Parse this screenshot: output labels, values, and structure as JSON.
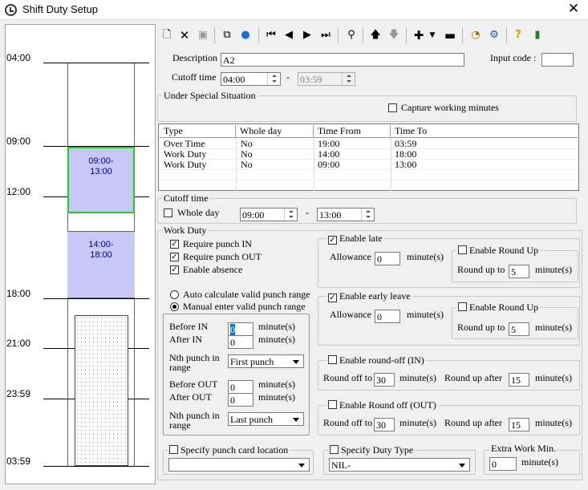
{
  "window": {
    "title": "Shift Duty Setup"
  },
  "timeline": {
    "labels": [
      "04:00",
      "09:00",
      "12:00",
      "18:00",
      "21:00",
      "23:59",
      "03:59"
    ],
    "blocks": [
      {
        "start": "09:00",
        "end": "13:00",
        "label": "09:00-\n13:00"
      },
      {
        "start": "14:00",
        "end": "18:00",
        "label": "14:00-\n18:00"
      }
    ]
  },
  "toolbar": {
    "icons": [
      "new-icon",
      "delete-icon",
      "save-icon",
      "copy-icon",
      "globe-icon",
      "first-icon",
      "prev-icon",
      "next-icon",
      "last-icon",
      "binoculars-icon",
      "up-arrow-icon",
      "down-arrow-icon",
      "add-icon",
      "dropdown-icon",
      "remove-icon",
      "clock-icon",
      "settings-icon",
      "help-icon",
      "exit-icon"
    ]
  },
  "form": {
    "description_label": "Description",
    "description": "A2",
    "input_code_label": "Input code :",
    "input_code": "",
    "cutoff_label": "Cutoff time",
    "cutoff_from": "04:00",
    "cutoff_dash": "-",
    "cutoff_to": "03:59"
  },
  "special": {
    "title": "Under Special Situation",
    "capture_label": "Capture working minutes"
  },
  "table": {
    "headers": [
      "Type",
      "Whole day",
      "Time From",
      "Time To"
    ],
    "rows": [
      [
        "Over Time",
        "No",
        "19:00",
        "03:59"
      ],
      [
        "Work Duty",
        "No",
        "14:00",
        "18:00"
      ],
      [
        "Work Duty",
        "No",
        "09:00",
        "13:00"
      ]
    ]
  },
  "cutoff2": {
    "title": "Cutoff time",
    "whole_day": "Whole day",
    "from": "09:00",
    "dash": "-",
    "to": "13:00"
  },
  "work_duty": {
    "title": "Work Duty",
    "req_in": "Require punch IN",
    "req_out": "Require punch OUT",
    "absence": "Enable absence",
    "auto": "Auto calculate valid punch range",
    "manual": "Manual enter valid punch range",
    "before_in": "Before IN",
    "before_in_val": "0",
    "after_in": "After IN",
    "after_in_val": "0",
    "minutes": "minute(s)",
    "nth_in": "Nth punch in\nrange",
    "nth_in_val": "First punch",
    "before_out": "Before OUT",
    "before_out_val": "0",
    "after_out": "After OUT",
    "after_out_val": "0",
    "nth_out": "Nth punch in\nrange",
    "nth_out_val": "Last punch"
  },
  "late": {
    "label": "Enable late",
    "allowance": "Allowance",
    "allowance_val": "0",
    "minutes": "minute(s)",
    "round_up": "Enable Round Up",
    "round_up_to": "Round up to",
    "round_val": "5"
  },
  "early": {
    "label": "Enable early leave",
    "allowance": "Allowance",
    "allowance_val": "0",
    "minutes": "minute(s)",
    "round_up": "Enable Round Up",
    "round_up_to": "Round up to",
    "round_val": "5"
  },
  "roundoff_in": {
    "label": "Enable round-off (IN)",
    "round_off_to": "Round off to",
    "val1": "30",
    "minutes": "minute(s)",
    "round_up_after": "Round up after",
    "val2": "15"
  },
  "roundoff_out": {
    "label": "Enable Round off (OUT)",
    "round_off_to": "Round off to",
    "val1": "30",
    "minutes": "minute(s)",
    "round_up_after": "Round up after",
    "val2": "15"
  },
  "bottom": {
    "punch_loc": "Specify punch card location",
    "duty_type": "Specify Duty Type",
    "duty_val": "NIL-",
    "extra": "Extra Work Min.",
    "extra_val": "0",
    "minutes": "minute(s)"
  }
}
